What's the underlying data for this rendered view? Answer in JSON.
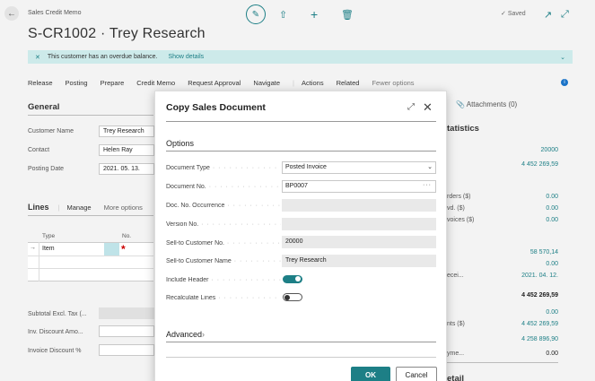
{
  "header": {
    "breadcrumb": "Sales Credit Memo",
    "title": "S-CR1002 · Trey Research",
    "saved": "Saved"
  },
  "notice": {
    "text": "This customer has an overdue balance.",
    "link": "Show details"
  },
  "actions": [
    "Release",
    "Posting",
    "Prepare",
    "Credit Memo",
    "Request Approval",
    "Navigate",
    "Actions",
    "Related",
    "Fewer options"
  ],
  "general": {
    "title": "General",
    "fields": [
      {
        "label": "Customer Name",
        "value": "Trey Research"
      },
      {
        "label": "Contact",
        "value": "Helen Ray"
      },
      {
        "label": "Posting Date",
        "value": "2021. 05. 13."
      }
    ]
  },
  "lines": {
    "title": "Lines",
    "manage": "Manage",
    "more": "More options",
    "col_type": "Type",
    "col_no": "No.",
    "row_type": "Item",
    "required": "*"
  },
  "totals": {
    "subtotal": "Subtotal Excl. Tax (...",
    "inv_disc_amt": "Inv. Discount Amo...",
    "inv_disc_pct": "Invoice Discount %"
  },
  "side": {
    "attachments": "Attachments (0)",
    "statistics": "tatistics",
    "labels": [
      "rders ($)",
      "vd. ($)",
      "voices ($)",
      "ecei...",
      "nts ($)",
      "yme..."
    ],
    "values": [
      "20000",
      "4 452 269,59",
      "0.00",
      "0.00",
      "0.00",
      "58 570,14",
      "0.00",
      "2021. 04. 12.",
      "4 452 269,59",
      "0.00",
      "4 452 269,59",
      "4 258 896,90",
      "0.00"
    ],
    "footer_label": "etail"
  },
  "dialog": {
    "title": "Copy Sales Document",
    "options_title": "Options",
    "advanced_title": "Advanced",
    "fields": {
      "doc_type_label": "Document Type",
      "doc_type_value": "Posted Invoice",
      "doc_no_label": "Document No.",
      "doc_no_value": "BP0007",
      "doc_no_occ_label": "Doc. No. Occurrence",
      "version_label": "Version No.",
      "sell_to_no_label": "Sell-to Customer No.",
      "sell_to_no_value": "20000",
      "sell_to_name_label": "Sell-to Customer Name",
      "sell_to_name_value": "Trey Research",
      "include_header_label": "Include Header",
      "recalc_label": "Recalculate Lines"
    },
    "include_header": true,
    "recalculate_lines": false,
    "ok": "OK",
    "cancel": "Cancel"
  }
}
